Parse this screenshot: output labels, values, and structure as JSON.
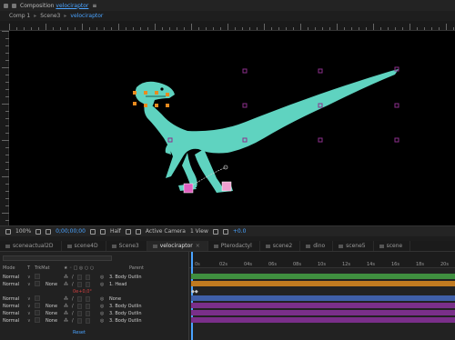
{
  "composition_panel": {
    "title_prefix": "Composition",
    "title_name": "velociraptor",
    "menu_glyph": "≡"
  },
  "comp_breadcrumb": [
    "Comp 1",
    "Scene3",
    "velociraptor"
  ],
  "viewer_toolbar": {
    "zoom": "100%",
    "timecode": "0;00;00;00",
    "resolution": "Half",
    "camera": "Active Camera",
    "views": "1 View",
    "exposure": "+0.0"
  },
  "timeline_tabs": [
    "sceneactual2D",
    "scene4D",
    "Scene3",
    "velociraptor",
    "Pterodactyl",
    "scene2",
    "dino",
    "scene5",
    "scene"
  ],
  "timeline_active_tab": "velociraptor",
  "layer_headers": {
    "mode": "Mode",
    "t": "T",
    "trkmat": "TrkMat",
    "parent": "Parent"
  },
  "layers": [
    {
      "mode": "Normal",
      "trkmat": "",
      "parent": "3. Body Outlin"
    },
    {
      "mode": "Normal",
      "trkmat": "None",
      "parent": "1. Head"
    },
    {
      "mode": "",
      "trkmat": "",
      "parent": "",
      "expr": "0e+0,0°"
    },
    {
      "mode": "Normal",
      "trkmat": "",
      "parent": "None"
    },
    {
      "mode": "Normal",
      "trkmat": "None",
      "parent": "3. Body Outlin"
    },
    {
      "mode": "Normal",
      "trkmat": "None",
      "parent": "3. Body Outlin"
    },
    {
      "mode": "Normal",
      "trkmat": "None",
      "parent": "3. Body Outlin"
    }
  ],
  "reset_label": "Reset",
  "time_ruler": [
    "0s",
    "02s",
    "04s",
    "06s",
    "08s",
    "10s",
    "12s",
    "14s",
    "16s",
    "18s",
    "20s"
  ],
  "colors": {
    "dino": "#5fd3c0",
    "accent": "#4aa3ff",
    "handle_orange": "#e88b1f",
    "null_purple": "#8c2f8c",
    "bar_green": "#3f8f3f",
    "bar_orange": "#c07a20",
    "bar_purple": "#7a2f8a",
    "bar_blue": "#3f5fa8"
  }
}
